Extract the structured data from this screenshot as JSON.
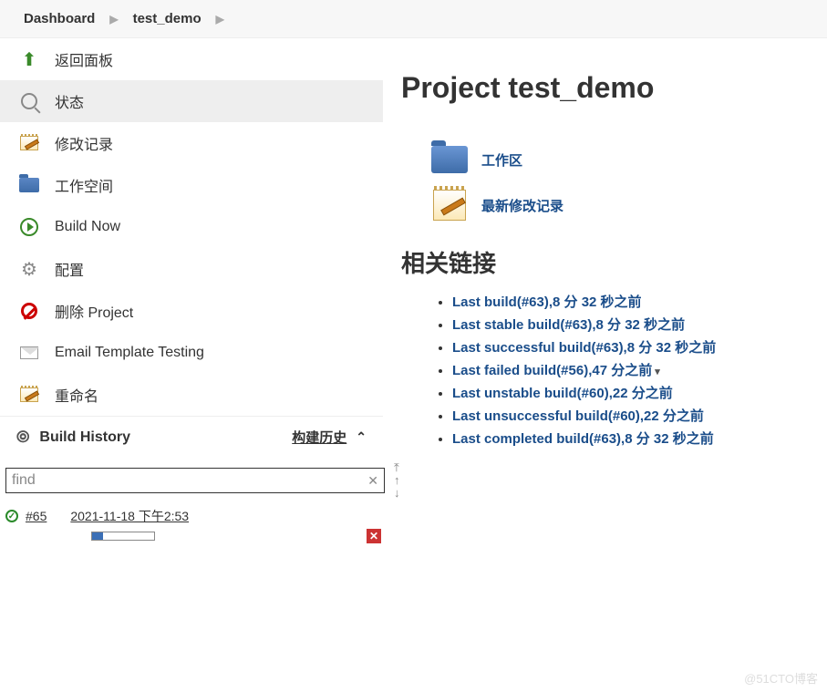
{
  "breadcrumbs": {
    "dashboard": "Dashboard",
    "project": "test_demo"
  },
  "sidebar": {
    "items": [
      {
        "label": "返回面板"
      },
      {
        "label": "状态"
      },
      {
        "label": "修改记录"
      },
      {
        "label": "工作空间"
      },
      {
        "label": "Build Now"
      },
      {
        "label": "配置"
      },
      {
        "label": "删除 Project"
      },
      {
        "label": "Email Template Testing"
      },
      {
        "label": "重命名"
      }
    ],
    "history": {
      "title": "Build History",
      "subtitle": "构建历史"
    },
    "find": {
      "value": "find"
    },
    "build": {
      "number": "#65",
      "date": "2021-11-18 下午2:53"
    }
  },
  "main": {
    "title": "Project test_demo",
    "links": {
      "workspace": "工作区",
      "changes": "最新修改记录"
    },
    "permalinks_heading": "相关链接",
    "permalinks": [
      "Last build(#63),8 分 32 秒之前",
      "Last stable build(#63),8 分 32 秒之前",
      "Last successful build(#63),8 分 32 秒之前",
      "Last failed build(#56),47 分之前",
      "Last unstable build(#60),22 分之前",
      "Last unsuccessful build(#60),22 分之前",
      "Last completed build(#63),8 分 32 秒之前"
    ]
  },
  "watermark": "@51CTO博客"
}
